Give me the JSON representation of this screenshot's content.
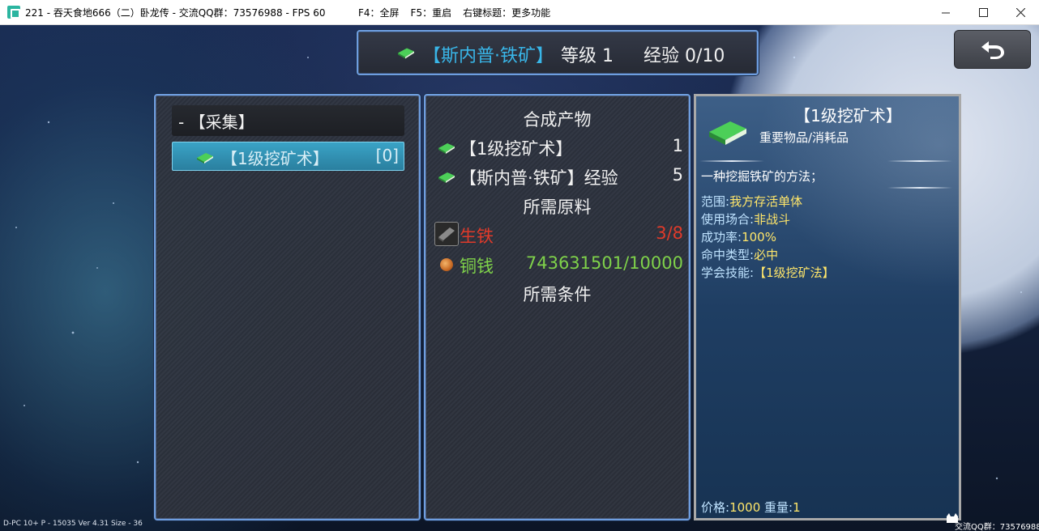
{
  "window": {
    "title": "221 - 吞天食地666（二）卧龙传 - 交流QQ群：73576988 - FPS 60",
    "hints": [
      "F4：全屏",
      "F5：重启",
      "右键标题：更多功能"
    ],
    "controls": {
      "minimize": "—",
      "maximize": "☐",
      "close": "✕"
    }
  },
  "header": {
    "skill_name": "【斯内普·铁矿】",
    "level": "等级 1",
    "exp": "经验 0/10"
  },
  "back_button": {
    "icon": "back-arrow-icon"
  },
  "left_panel": {
    "category": "-  【采集】",
    "items": [
      {
        "name": "【1级挖矿术】",
        "count": "[0]",
        "icon": "green-book-icon"
      }
    ]
  },
  "mid_panel": {
    "products_title": "合成产物",
    "products": [
      {
        "label": "【1级挖矿术】",
        "value": "1",
        "icon": "green-book-icon"
      },
      {
        "label": "【斯内普·铁矿】经验",
        "value": "5",
        "icon": "green-book-icon"
      }
    ],
    "materials_title": "所需原料",
    "materials": [
      {
        "label": "生铁",
        "value": "3/8",
        "icon": "iron-ingot-icon",
        "color": "#e03a2a"
      },
      {
        "label": "铜钱",
        "value": "743631501/10000",
        "icon": "copper-coin-icon",
        "color": "#7fd24a"
      }
    ],
    "conditions_title": "所需条件"
  },
  "info_panel": {
    "name": "【1级挖矿术】",
    "type": "重要物品/消耗品",
    "description": "一种挖掘铁矿的方法；",
    "stats": [
      {
        "key": "范围:",
        "value": "我方存活单体"
      },
      {
        "key": "使用场合:",
        "value": "非战斗"
      },
      {
        "key": "成功率:",
        "value": "100%"
      },
      {
        "key": "命中类型:",
        "value": "必中"
      },
      {
        "key": "学会技能:",
        "value": "【1级挖矿法】"
      }
    ],
    "price_label": "价格:",
    "price": "1000",
    "weight_label": "重量:",
    "weight": "1"
  },
  "footer": {
    "left": "D-PC 10+    P - 15035    Ver 4.31    Size - 36",
    "right": "交流QQ群：73576988"
  },
  "colors": {
    "border_blue": "#6e9ee0",
    "highlight_cyan": "#39b6e8",
    "yellow_value": "#ffe66a",
    "red_insufficient": "#e03a2a",
    "green_sufficient": "#7fd24a"
  }
}
